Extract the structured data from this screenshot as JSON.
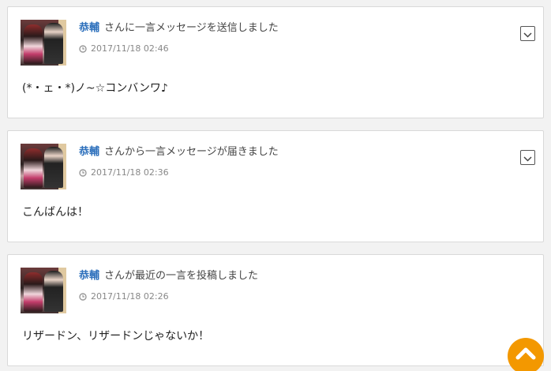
{
  "feed": {
    "items": [
      {
        "user": "恭輔",
        "action": "さんに一言メッセージを送信しました",
        "timestamp": "2017/11/18 02:46",
        "message": "(*・ェ・*)ノ~☆コンバンワ♪",
        "has_menu": true
      },
      {
        "user": "恭輔",
        "action": "さんから一言メッセージが届きました",
        "timestamp": "2017/11/18 02:36",
        "message": "こんばんは！",
        "has_menu": true
      },
      {
        "user": "恭輔",
        "action": "さんが最近の一言を投稿しました",
        "timestamp": "2017/11/18 02:26",
        "message": "リザードン、リザードンじゃないか！",
        "has_menu": false
      }
    ]
  },
  "icons": {
    "clock": "clock-icon",
    "menu": "chevron-down-icon",
    "scroll_top": "chevron-up-icon"
  },
  "colors": {
    "link": "#2a6ebb",
    "scroll_top_button": "#f39800",
    "card_border": "#d9d9d9"
  }
}
